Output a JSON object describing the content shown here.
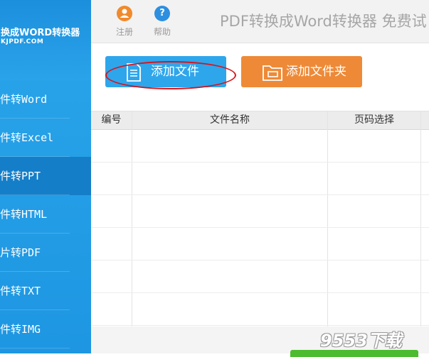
{
  "sidebar": {
    "logo_title": "换成WORD转换器",
    "logo_sub": "KJPDF.COM",
    "items": [
      {
        "label": "件转Word"
      },
      {
        "label": "件转Excel"
      },
      {
        "label": "件转PPT"
      },
      {
        "label": "件转HTML"
      },
      {
        "label": "片转PDF"
      },
      {
        "label": "件转TXT"
      },
      {
        "label": "件转IMG"
      }
    ]
  },
  "toolbar": {
    "register_label": "注册",
    "help_label": "帮助",
    "app_title": "PDF转换成Word转换器 免费试"
  },
  "actions": {
    "add_file_label": "添加文件",
    "add_folder_label": "添加文件夹"
  },
  "table": {
    "headers": [
      "编号",
      "文件名称",
      "页码选择"
    ]
  },
  "watermark": "9553下载",
  "colors": {
    "sidebar": "#2aa6ea",
    "sidebar_active": "#157ec8",
    "add_file_button": "#2ea6ec",
    "add_folder_button": "#ee8a37",
    "annotation_ellipse": "#d7141a"
  }
}
